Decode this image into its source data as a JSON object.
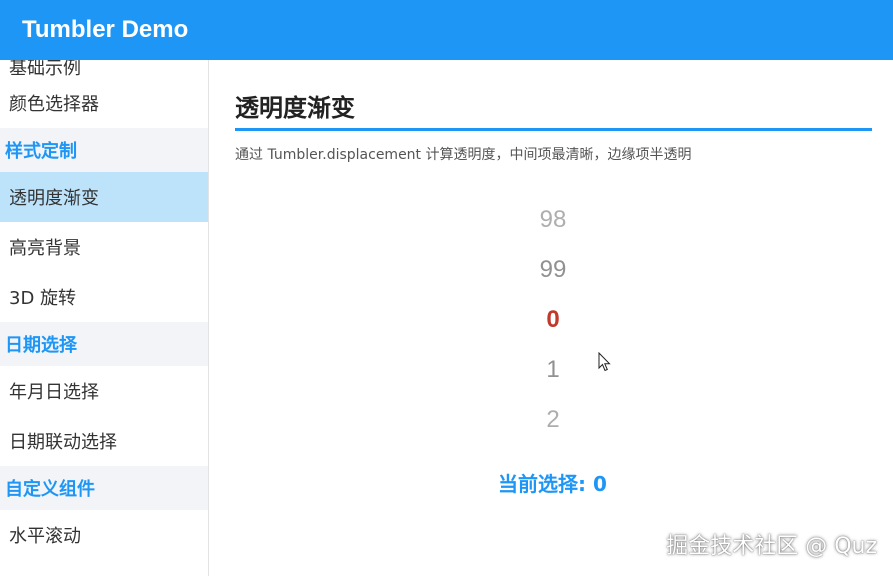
{
  "app": {
    "title": "Tumbler Demo"
  },
  "sidebar": {
    "items": [
      {
        "type": "item",
        "label": "基础示例"
      },
      {
        "type": "item",
        "label": "颜色选择器"
      },
      {
        "type": "group",
        "label": "样式定制"
      },
      {
        "type": "item",
        "label": "透明度渐变",
        "active": true
      },
      {
        "type": "item",
        "label": "高亮背景"
      },
      {
        "type": "item",
        "label": "3D 旋转"
      },
      {
        "type": "group",
        "label": "日期选择"
      },
      {
        "type": "item",
        "label": "年月日选择"
      },
      {
        "type": "item",
        "label": "日期联动选择"
      },
      {
        "type": "group",
        "label": "自定义组件"
      },
      {
        "type": "item",
        "label": "水平滚动"
      }
    ]
  },
  "main": {
    "title": "透明度渐变",
    "description": "通过 Tumbler.displacement 计算透明度，中间项最清晰，边缘项半透明",
    "tumbler": {
      "items": [
        "98",
        "99",
        "0",
        "1",
        "2"
      ],
      "current_index": 2
    },
    "current_selection": "当前选择: 0"
  },
  "watermark": "掘金技术社区 @ Quz",
  "colors": {
    "accent": "#1e96f5",
    "active_item_bg": "#bde3fb",
    "group_bg": "#f2f4f7",
    "current_value": "#c0392b"
  }
}
